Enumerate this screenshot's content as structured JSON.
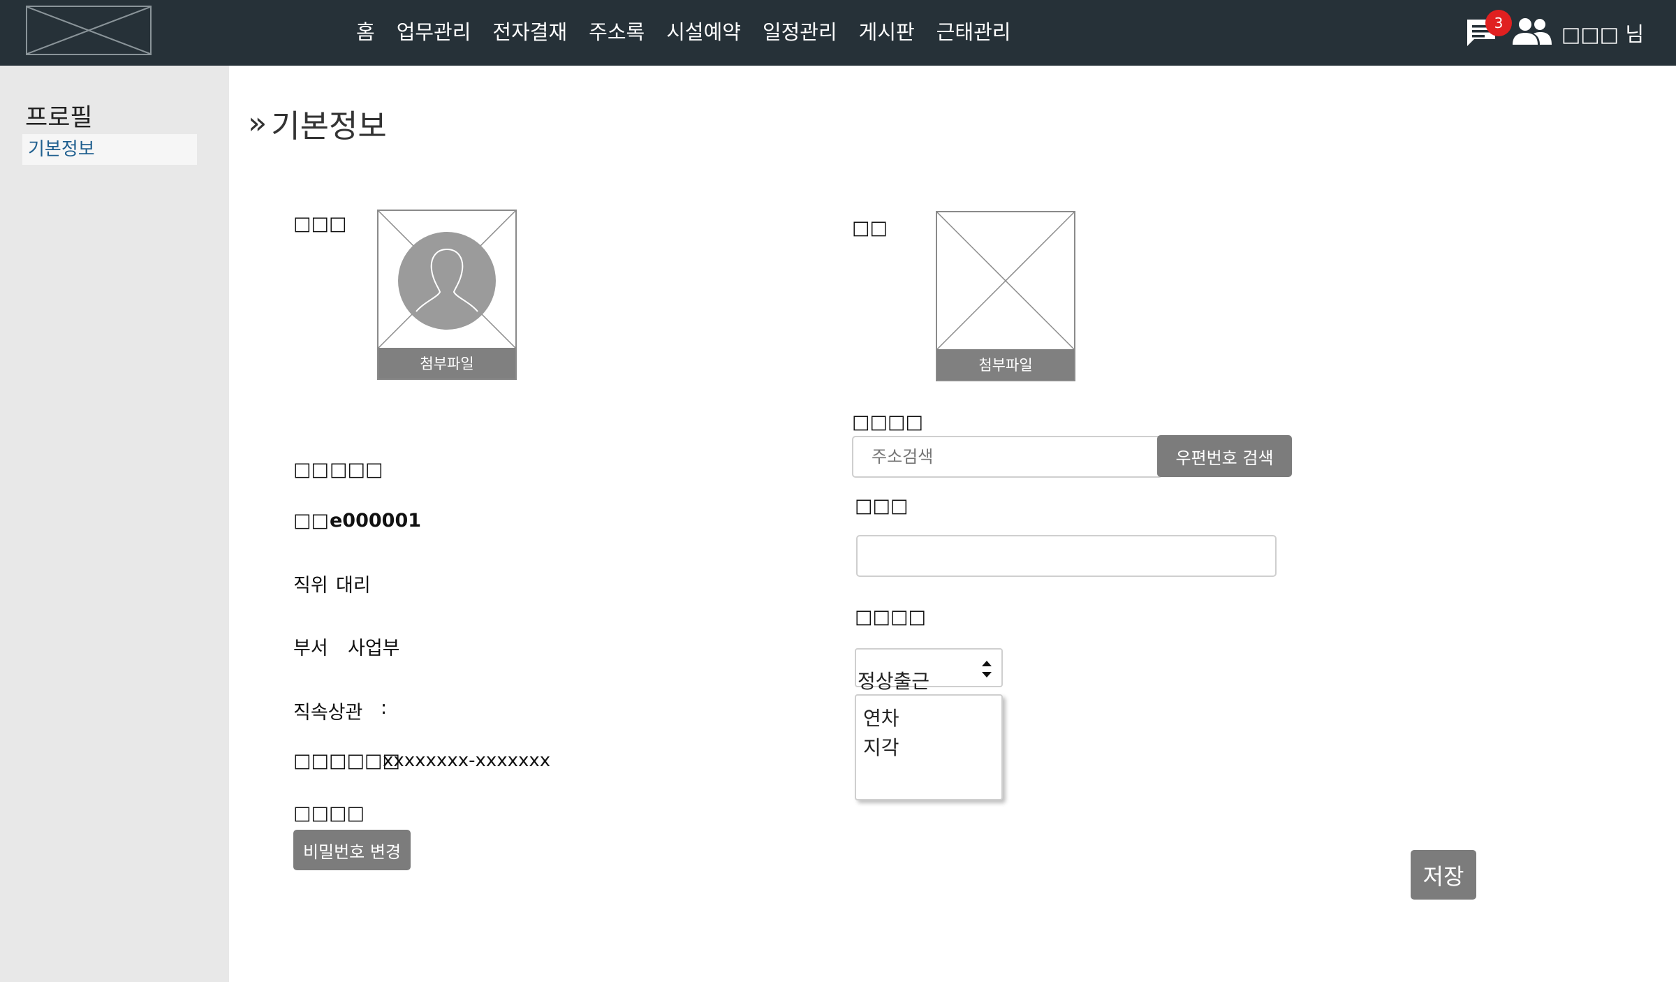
{
  "header": {
    "nav": [
      "홈",
      "업무관리",
      "전자결재",
      "주소록",
      "시설예약",
      "일정관리",
      "게시판",
      "근태관리"
    ],
    "notification_count": "3",
    "user_name": "□□□ 님"
  },
  "sidebar": {
    "title": "프로필",
    "items": [
      {
        "label": "기본정보"
      }
    ]
  },
  "main": {
    "title": "기본정보",
    "profile_photo_label": "□□□",
    "profile_attach_label": "첨부파일",
    "sign_label": "□□",
    "sign_attach_label": "첨부파일",
    "name_label": "□□",
    "name_value": "□□□",
    "emp_label": "□□",
    "emp_value": "e000001",
    "position_label": "직위",
    "position_value": "대리",
    "dept_label": "부서",
    "dept_value": "사업부",
    "manager_label": "직속상관",
    "manager_value": ":",
    "rrn_label": "□□□□□□",
    "rrn_value": "xxxxxxxx-xxxxxxx",
    "password_label": "□□□□",
    "password_button": "비밀번호 변경",
    "address_label": "□□□□",
    "address_placeholder": "주소검색",
    "zip_button": "우편번호 검색",
    "detail_label": "□□□",
    "detail_value": "",
    "status_label": "□□□□",
    "status_value": "정상출근",
    "status_options": [
      "연차",
      "지각"
    ],
    "save_button": "저장"
  },
  "colors": {
    "topbar": "#263138",
    "sidebar": "#e8e8e8",
    "button_gray": "#7c7c7c",
    "badge": "#e02020",
    "link_blue": "#1f5f8f"
  }
}
